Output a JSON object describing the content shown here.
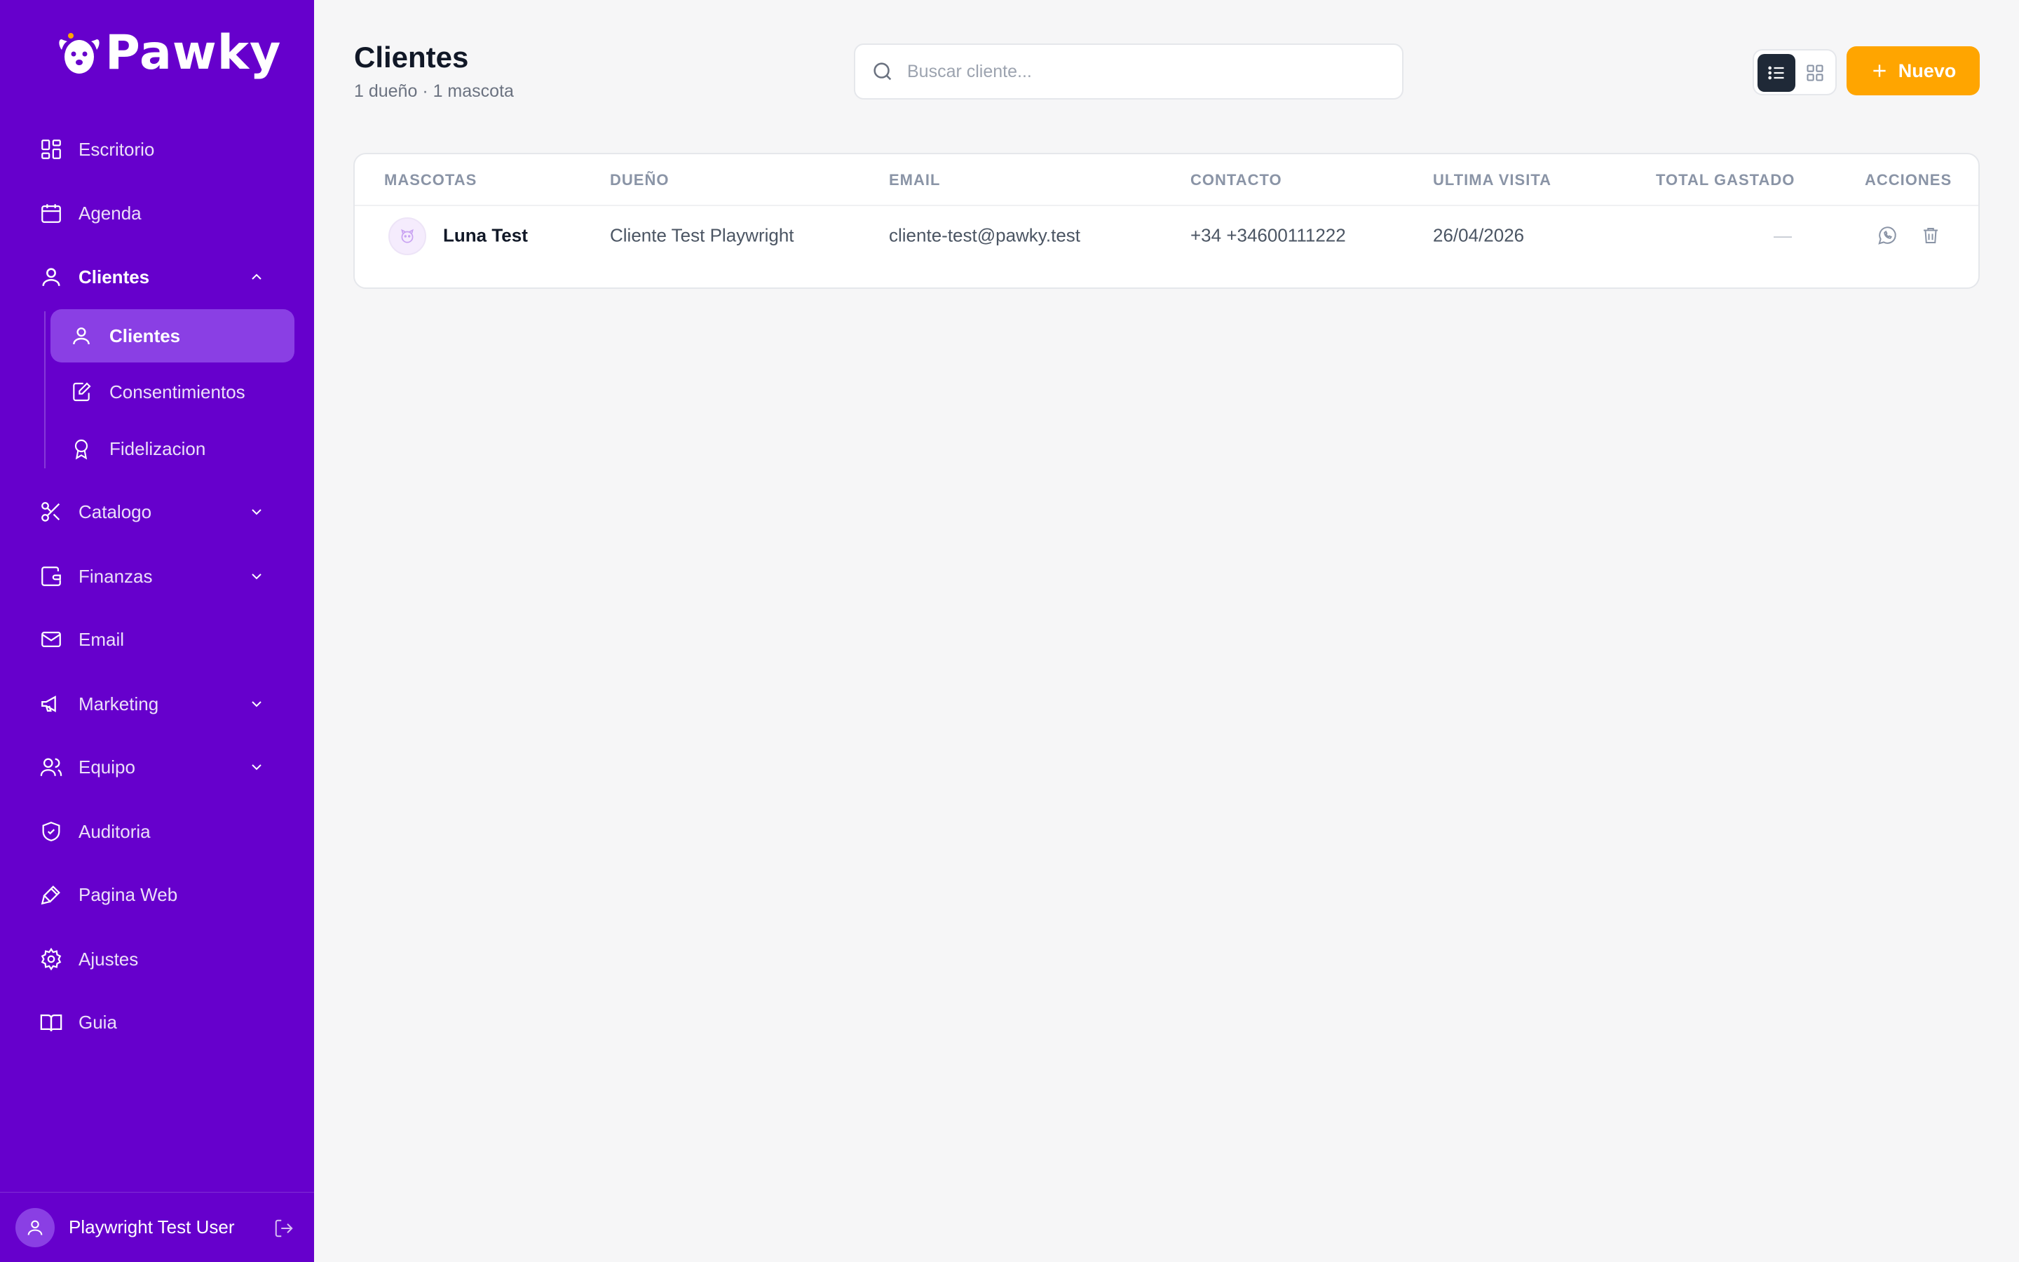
{
  "brand": {
    "name": "Pawky"
  },
  "sidebar": {
    "items": [
      {
        "label": "Escritorio",
        "icon": "dashboard-icon"
      },
      {
        "label": "Agenda",
        "icon": "calendar-icon"
      },
      {
        "label": "Clientes",
        "icon": "user-icon",
        "expanded": true
      },
      {
        "label": "Catalogo",
        "icon": "scissors-icon"
      },
      {
        "label": "Finanzas",
        "icon": "wallet-icon"
      },
      {
        "label": "Email",
        "icon": "mail-icon"
      },
      {
        "label": "Marketing",
        "icon": "megaphone-icon"
      },
      {
        "label": "Equipo",
        "icon": "users-icon"
      },
      {
        "label": "Auditoria",
        "icon": "shield-check-icon"
      },
      {
        "label": "Pagina Web",
        "icon": "brush-icon"
      },
      {
        "label": "Ajustes",
        "icon": "gear-icon"
      },
      {
        "label": "Guia",
        "icon": "book-icon"
      }
    ],
    "subitems": [
      {
        "label": "Clientes",
        "icon": "user-icon",
        "selected": true
      },
      {
        "label": "Consentimientos",
        "icon": "edit-doc-icon"
      },
      {
        "label": "Fidelizacion",
        "icon": "award-icon"
      }
    ],
    "user": {
      "name": "Playwright Test User"
    }
  },
  "header": {
    "title": "Clientes",
    "subtitle": "1 dueño · 1 mascota",
    "search_placeholder": "Buscar cliente...",
    "new_button": "Nuevo"
  },
  "table": {
    "columns": [
      "MASCOTAS",
      "DUEÑO",
      "EMAIL",
      "CONTACTO",
      "ULTIMA VISITA",
      "TOTAL GASTADO",
      "ACCIONES"
    ],
    "rows": [
      {
        "pet": "Luna Test",
        "owner": "Cliente Test Playwright",
        "email": "cliente-test@pawky.test",
        "contact": "+34 +34600111222",
        "last_visit": "26/04/2026",
        "total_spent": "—"
      }
    ]
  },
  "colors": {
    "sidebar": "#6600cc",
    "selected_item": "#8a3fe4",
    "accent": "#ffa500",
    "background": "#f6f6f7"
  }
}
